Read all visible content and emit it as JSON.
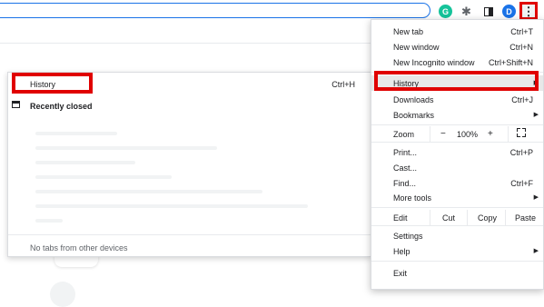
{
  "toolbar": {
    "avatar_letter": "D",
    "grammarly_letter": "G",
    "puzzle_glyph": "✱",
    "menu_glyph": "⋮",
    "icons": [
      "grammarly-icon",
      "puzzle-icon",
      "side-panel-icon",
      "avatar",
      "kebab-menu-icon"
    ]
  },
  "history_submenu": {
    "history_label": "History",
    "history_shortcut": "Ctrl+H",
    "recently_closed_label": "Recently closed",
    "footer_text": "No tabs from other devices"
  },
  "menu": {
    "new_tab": "New tab",
    "new_tab_sc": "Ctrl+T",
    "new_window": "New window",
    "new_window_sc": "Ctrl+N",
    "new_incognito": "New Incognito window",
    "new_incognito_sc": "Ctrl+Shift+N",
    "history": "History",
    "downloads": "Downloads",
    "downloads_sc": "Ctrl+J",
    "bookmarks": "Bookmarks",
    "zoom": "Zoom",
    "zoom_minus": "−",
    "zoom_value": "100%",
    "zoom_plus": "+",
    "print": "Print...",
    "print_sc": "Ctrl+P",
    "cast": "Cast...",
    "find": "Find...",
    "find_sc": "Ctrl+F",
    "more_tools": "More tools",
    "edit": "Edit",
    "cut": "Cut",
    "copy": "Copy",
    "paste": "Paste",
    "settings": "Settings",
    "help": "Help",
    "exit": "Exit",
    "arrow": "▶"
  },
  "colors": {
    "highlight_red": "#e00000",
    "accent_blue": "#1a73e8",
    "grammarly_green": "#15c39a"
  }
}
